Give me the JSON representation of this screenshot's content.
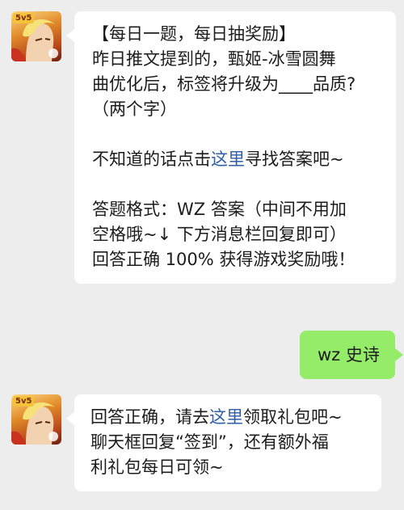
{
  "messages": [
    {
      "sender": "bot",
      "avatar": {
        "badge": "5v5",
        "icon": "game-hero-avatar"
      },
      "lines": [
        "【每日一题，每日抽奖励】",
        "昨日推文提到的，甄姬-冰雪圆舞",
        "曲优化后，标签将升级为____品质?",
        "（两个字）"
      ],
      "hint": {
        "before": "不知道的话点击",
        "link": "这里",
        "after": "寻找答案吧~"
      },
      "format_lines": [
        "答题格式：WZ 答案（中间不用加",
        "空格哦~↓ 下方消息栏回复即可）",
        "回答正确 100% 获得游戏奖励哦！"
      ]
    },
    {
      "sender": "user",
      "text": "wz 史诗"
    },
    {
      "sender": "bot",
      "avatar": {
        "badge": "5v5",
        "icon": "game-hero-avatar"
      },
      "reply": {
        "before": "回答正确，请去",
        "link": "这里",
        "after": "领取礼包吧~"
      },
      "lines": [
        "聊天框回复“签到”，还有额外福",
        "利礼包每日可领~"
      ]
    }
  ],
  "colors": {
    "background": "#ededed",
    "incoming_bubble": "#ffffff",
    "outgoing_bubble": "#95ec69",
    "link": "#2f5ea8"
  }
}
